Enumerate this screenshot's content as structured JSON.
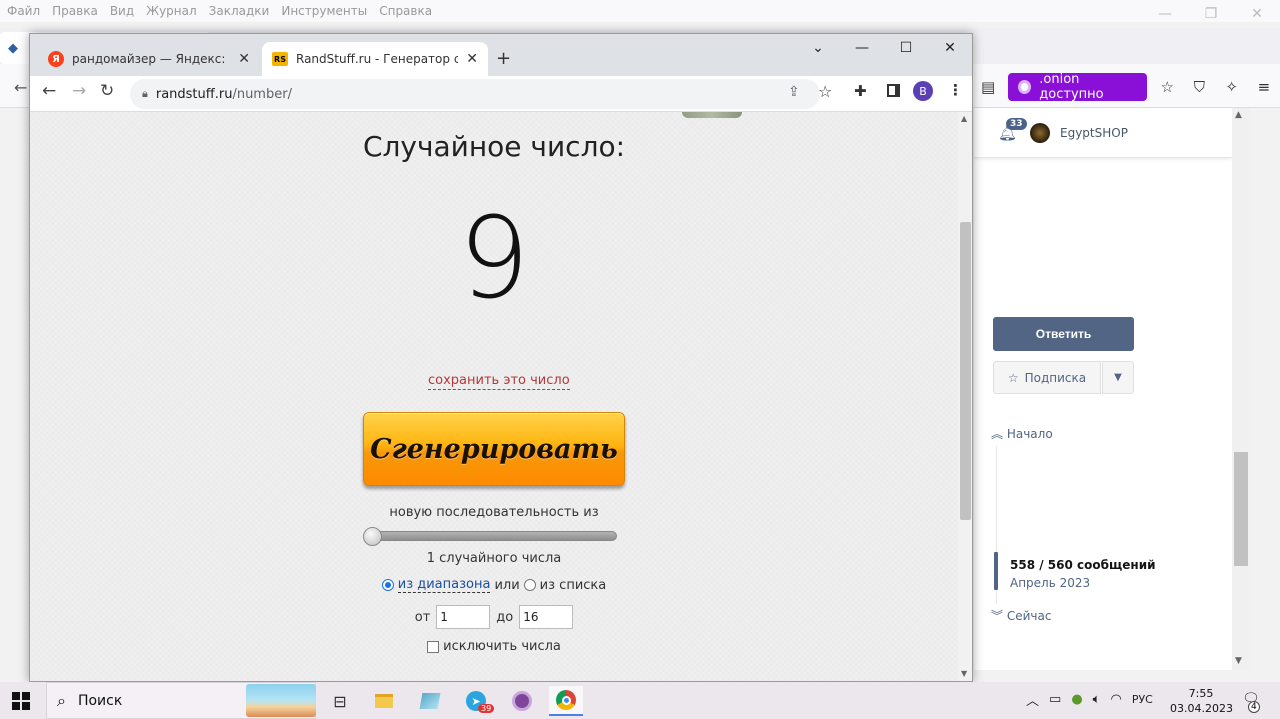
{
  "firefox": {
    "menu": [
      "Файл",
      "Правка",
      "Вид",
      "Журнал",
      "Закладки",
      "Инструменты",
      "Справка"
    ],
    "onion_label": ".onion доступно"
  },
  "forum": {
    "notification_count": "33",
    "user_name": "EgyptSHOP",
    "reply_label": "Ответить",
    "subscribe_label": "Подписка",
    "start_label": "Начало",
    "messages_count": "558 / 560 сообщений",
    "messages_date": "Апрель 2023",
    "now_label": "Сейчас"
  },
  "chrome": {
    "tabs": [
      {
        "title": "рандомайзер — Яндекс: нашлось",
        "favicon_text": "Я",
        "active": false
      },
      {
        "title": "RandStuff.ru - Генератор случайных",
        "favicon_text": "RS",
        "active": true
      }
    ],
    "url_host": "randstuff.ru",
    "url_path": "/number/",
    "profile_letter": "В"
  },
  "page": {
    "heading": "Случайное число:",
    "number": "9",
    "save_link": "сохранить это число",
    "generate_label": "Сгенерировать",
    "sequence_label": "новую последовательность из",
    "sequence_count": 1,
    "count_label": "1 случайного числа",
    "mode_range_label": "из диапазона",
    "mode_or": "или",
    "mode_list_label": "из списка",
    "range_from_label": "от",
    "range_from_value": "1",
    "range_to_label": "до",
    "range_to_value": "16",
    "exclude_label": "исключить числа"
  },
  "taskbar": {
    "search_label": "Поиск",
    "telegram_badge": "39",
    "language": "РУС",
    "time": "7:55",
    "date": "03.04.2023",
    "notifications": "4"
  },
  "colors": {
    "onion_accent": "#8a10d8",
    "forum_primary": "#526585",
    "generate_button": "#ffb30f",
    "link_red": "#b03a3a"
  }
}
